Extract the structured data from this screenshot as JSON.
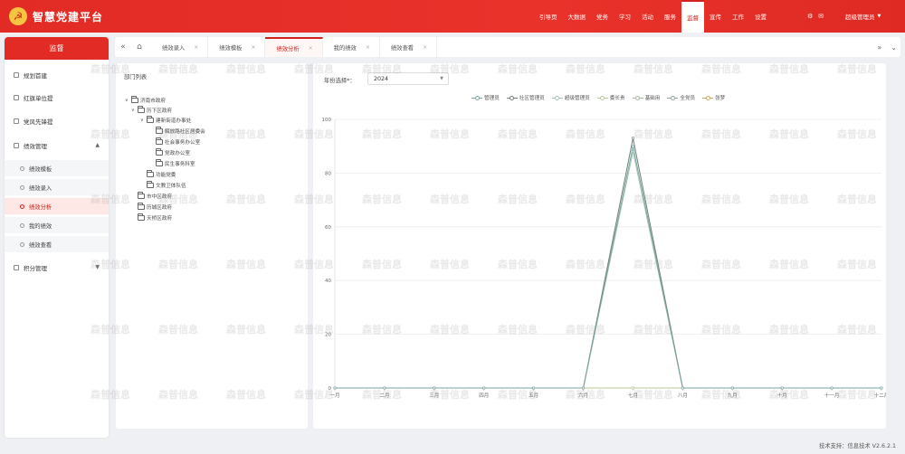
{
  "header": {
    "title": "智慧党建平台",
    "emblem": "☭",
    "nav": [
      "引导页",
      "大数据",
      "党务",
      "学习",
      "活动",
      "服务",
      "监督",
      "宣传",
      "工作",
      "设置"
    ],
    "active_nav": "监督",
    "user": "超级管理员",
    "icons": [
      "bell-icon",
      "chat-icon"
    ]
  },
  "sidebar": {
    "title": "监督",
    "items": [
      {
        "label": "规划首建",
        "type": "item"
      },
      {
        "label": "红旗单位提",
        "type": "item"
      },
      {
        "label": "党风先锋提",
        "type": "item"
      },
      {
        "label": "绩效管理",
        "type": "group",
        "expanded": true
      },
      {
        "label": "绩效模板",
        "type": "sub"
      },
      {
        "label": "绩效录入",
        "type": "sub"
      },
      {
        "label": "绩效分析",
        "type": "sub",
        "active": true
      },
      {
        "label": "我的绩效",
        "type": "sub"
      },
      {
        "label": "绩效查看",
        "type": "sub"
      },
      {
        "label": "积分管理",
        "type": "group",
        "expanded": false
      }
    ]
  },
  "tabs": {
    "items": [
      "绩效录入",
      "绩效模板",
      "绩效分析",
      "我的绩效",
      "绩效查看"
    ],
    "active": "绩效分析",
    "close_glyph": "×",
    "prev_glyph": "«",
    "home_glyph": "⌂",
    "next_glyph": "»",
    "menu_glyph": "⌄"
  },
  "dept": {
    "title": "部门列表",
    "tree": [
      {
        "label": "济南市政府",
        "level": 0,
        "expanded": true
      },
      {
        "label": "历下区政府",
        "level": 1,
        "expanded": true
      },
      {
        "label": "建新街道办事处",
        "level": 2,
        "expanded": true
      },
      {
        "label": "解放路社区居委会",
        "level": 3
      },
      {
        "label": "社会事务办公室",
        "level": 3
      },
      {
        "label": "党政办公室",
        "level": 3
      },
      {
        "label": "民生事务科室",
        "level": 3
      },
      {
        "label": "功能党委",
        "level": 2
      },
      {
        "label": "文教卫体队伍",
        "level": 2
      },
      {
        "label": "市中区政府",
        "level": 1
      },
      {
        "label": "历城区政府",
        "level": 1
      },
      {
        "label": "天桥区政府",
        "level": 1
      }
    ]
  },
  "filter": {
    "label": "年份选择*：",
    "value": "2024"
  },
  "chart_data": {
    "type": "line",
    "categories": [
      "一月",
      "二月",
      "三月",
      "四月",
      "五月",
      "六月",
      "七月",
      "八月",
      "九月",
      "十月",
      "十一月",
      "十二月"
    ],
    "ylim": [
      0,
      100
    ],
    "yticks": [
      0,
      20,
      40,
      60,
      80,
      100
    ],
    "series": [
      {
        "name": "管理员",
        "color": "#7aa3a2",
        "values": [
          0,
          0,
          0,
          0,
          0,
          0,
          90,
          0,
          0,
          0,
          0,
          0
        ]
      },
      {
        "name": "社区管理员",
        "color": "#6f7d75",
        "values": [
          0,
          0,
          0,
          0,
          0,
          0,
          93,
          0,
          0,
          0,
          0,
          0
        ]
      },
      {
        "name": "超级管理员",
        "color": "#9fc7b2",
        "values": [
          0,
          0,
          0,
          0,
          0,
          0,
          88,
          0,
          0,
          0,
          0,
          0
        ]
      },
      {
        "name": "委长贵",
        "color": "#b9c99a",
        "values": [
          0,
          0,
          0,
          0,
          0,
          0,
          0,
          0,
          0,
          0,
          0,
          0
        ]
      },
      {
        "name": "基础用",
        "color": "#a8b5a0",
        "values": [
          0,
          0,
          0,
          0,
          0,
          0,
          0,
          0,
          0,
          0,
          0,
          0
        ]
      },
      {
        "name": "全党员",
        "color": "#8fa6a0",
        "values": [
          0,
          0,
          0,
          0,
          0,
          0,
          0,
          0,
          0,
          0,
          0,
          0
        ]
      },
      {
        "name": "张梦",
        "color": "#c8a86a",
        "values": [
          0,
          0,
          0,
          0,
          0,
          0,
          0,
          0,
          0,
          0,
          0,
          0
        ]
      }
    ]
  },
  "watermark": "森普信息",
  "footer": "技术支持：信息技术  V2.6.2.1",
  "colors": {
    "primary": "#e22b25",
    "active_bg": "#fde8e6"
  }
}
